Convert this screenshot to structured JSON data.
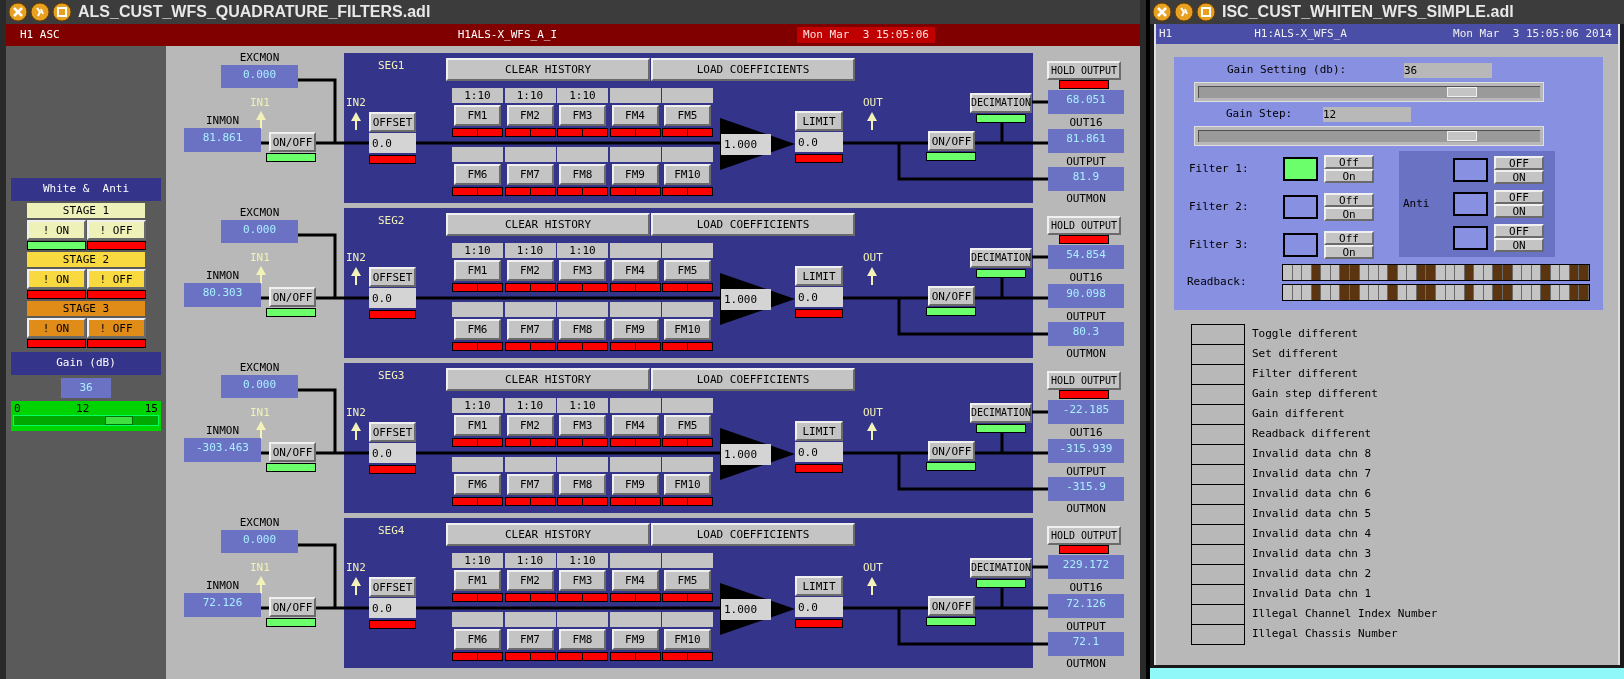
{
  "left_window": {
    "title": "ALS_CUST_WFS_QUADRATURE_FILTERS.adl",
    "header": {
      "site": "H1 ASC",
      "channel": "H1ALS-X_WFS_A_I",
      "datetime": "Mon Mar  3 15:05:06"
    },
    "whitening": {
      "title": "White &  Anti",
      "stages": [
        {
          "label": "STAGE 1",
          "color": "#eef2b8",
          "on_button": "! ON",
          "off_button": "! OFF",
          "on_lit": true,
          "off_lit": false
        },
        {
          "label": "STAGE 2",
          "color": "#f8da40",
          "on_button": "! ON",
          "off_button": "! OFF",
          "on_lit": false,
          "off_lit": false
        },
        {
          "label": "STAGE 3",
          "color": "#e08c18",
          "on_button": "! ON",
          "off_button": "! OFF",
          "on_lit": false,
          "off_lit": false
        }
      ],
      "gain_title": "Gain (dB)",
      "gain_value": "36",
      "slider": {
        "min_label": "0",
        "mid_label": "12",
        "max_label": "15",
        "level": 0.73
      }
    },
    "segments": [
      {
        "name": "SEG1",
        "excmon_label": "EXCMON",
        "excmon": "0.000",
        "inmon_label": "INMON",
        "inmon": "81.861",
        "in1_label": "IN1",
        "in2_label": "IN2",
        "input_switch": {
          "label": "ON/OFF",
          "on": true
        },
        "offset": {
          "label": "OFFSET",
          "value": "0.0",
          "on": false
        },
        "clear_history": "CLEAR HISTORY",
        "load_coefficients": "LOAD COEFFICIENTS",
        "filters": [
          {
            "label": "FM1",
            "ratio": "1:10",
            "on": false
          },
          {
            "label": "FM2",
            "ratio": "1:10",
            "on": false
          },
          {
            "label": "FM3",
            "ratio": "1:10",
            "on": false
          },
          {
            "label": "FM4",
            "on": false
          },
          {
            "label": "FM5",
            "on": false
          },
          {
            "label": "FM6",
            "on": false
          },
          {
            "label": "FM7",
            "on": false
          },
          {
            "label": "FM8",
            "on": false
          },
          {
            "label": "FM9",
            "on": false
          },
          {
            "label": "FM10",
            "on": false
          }
        ],
        "gain": "1.000",
        "limit": {
          "label": "LIMIT",
          "value": "0.0",
          "on": false
        },
        "out_label": "OUT",
        "output_switch": {
          "label": "ON/OFF",
          "on": true
        },
        "decimation": {
          "label": "DECIMATION",
          "on": true
        },
        "hold_output": {
          "label": "HOLD OUTPUT",
          "on": false
        },
        "out16": "68.051",
        "out16_label": "OUT16",
        "output": "81.861",
        "output_label": "OUTPUT",
        "outmon": "81.9",
        "outmon_label": "OUTMON"
      },
      {
        "name": "SEG2",
        "excmon_label": "EXCMON",
        "excmon": "0.000",
        "inmon_label": "INMON",
        "inmon": "80.303",
        "in1_label": "IN1",
        "in2_label": "IN2",
        "input_switch": {
          "label": "ON/OFF",
          "on": true
        },
        "offset": {
          "label": "OFFSET",
          "value": "0.0",
          "on": false
        },
        "clear_history": "CLEAR HISTORY",
        "load_coefficients": "LOAD COEFFICIENTS",
        "filters": [
          {
            "label": "FM1",
            "ratio": "1:10",
            "on": false
          },
          {
            "label": "FM2",
            "ratio": "1:10",
            "on": false
          },
          {
            "label": "FM3",
            "ratio": "1:10",
            "on": false
          },
          {
            "label": "FM4",
            "on": false
          },
          {
            "label": "FM5",
            "on": false
          },
          {
            "label": "FM6",
            "on": false
          },
          {
            "label": "FM7",
            "on": false
          },
          {
            "label": "FM8",
            "on": false
          },
          {
            "label": "FM9",
            "on": false
          },
          {
            "label": "FM10",
            "on": false
          }
        ],
        "gain": "1.000",
        "limit": {
          "label": "LIMIT",
          "value": "0.0",
          "on": false
        },
        "out_label": "OUT",
        "output_switch": {
          "label": "ON/OFF",
          "on": true
        },
        "decimation": {
          "label": "DECIMATION",
          "on": true
        },
        "hold_output": {
          "label": "HOLD OUTPUT",
          "on": false
        },
        "out16": "54.854",
        "out16_label": "OUT16",
        "output": "90.098",
        "output_label": "OUTPUT",
        "outmon": "80.3",
        "outmon_label": "OUTMON"
      },
      {
        "name": "SEG3",
        "excmon_label": "EXCMON",
        "excmon": "0.000",
        "inmon_label": "INMON",
        "inmon": "-303.463",
        "in1_label": "IN1",
        "in2_label": "IN2",
        "input_switch": {
          "label": "ON/OFF",
          "on": true
        },
        "offset": {
          "label": "OFFSET",
          "value": "0.0",
          "on": false
        },
        "clear_history": "CLEAR HISTORY",
        "load_coefficients": "LOAD COEFFICIENTS",
        "filters": [
          {
            "label": "FM1",
            "ratio": "1:10",
            "on": false
          },
          {
            "label": "FM2",
            "ratio": "1:10",
            "on": false
          },
          {
            "label": "FM3",
            "ratio": "1:10",
            "on": false
          },
          {
            "label": "FM4",
            "on": false
          },
          {
            "label": "FM5",
            "on": false
          },
          {
            "label": "FM6",
            "on": false
          },
          {
            "label": "FM7",
            "on": false
          },
          {
            "label": "FM8",
            "on": false
          },
          {
            "label": "FM9",
            "on": false
          },
          {
            "label": "FM10",
            "on": false
          }
        ],
        "gain": "1.000",
        "limit": {
          "label": "LIMIT",
          "value": "0.0",
          "on": false
        },
        "out_label": "OUT",
        "output_switch": {
          "label": "ON/OFF",
          "on": true
        },
        "decimation": {
          "label": "DECIMATION",
          "on": true
        },
        "hold_output": {
          "label": "HOLD OUTPUT",
          "on": false
        },
        "out16": "-22.185",
        "out16_label": "OUT16",
        "output": "-315.939",
        "output_label": "OUTPUT",
        "outmon": "-315.9",
        "outmon_label": "OUTMON"
      },
      {
        "name": "SEG4",
        "excmon_label": "EXCMON",
        "excmon": "0.000",
        "inmon_label": "INMON",
        "inmon": "72.126",
        "in1_label": "IN1",
        "in2_label": "IN2",
        "input_switch": {
          "label": "ON/OFF",
          "on": true
        },
        "offset": {
          "label": "OFFSET",
          "value": "0.0",
          "on": false
        },
        "clear_history": "CLEAR HISTORY",
        "load_coefficients": "LOAD COEFFICIENTS",
        "filters": [
          {
            "label": "FM1",
            "ratio": "1:10",
            "on": false
          },
          {
            "label": "FM2",
            "ratio": "1:10",
            "on": false
          },
          {
            "label": "FM3",
            "ratio": "1:10",
            "on": false
          },
          {
            "label": "FM4",
            "on": false
          },
          {
            "label": "FM5",
            "on": false
          },
          {
            "label": "FM6",
            "on": false
          },
          {
            "label": "FM7",
            "on": false
          },
          {
            "label": "FM8",
            "on": false
          },
          {
            "label": "FM9",
            "on": false
          },
          {
            "label": "FM10",
            "on": false
          }
        ],
        "gain": "1.000",
        "limit": {
          "label": "LIMIT",
          "value": "0.0",
          "on": false
        },
        "out_label": "OUT",
        "output_switch": {
          "label": "ON/OFF",
          "on": true
        },
        "decimation": {
          "label": "DECIMATION",
          "on": true
        },
        "hold_output": {
          "label": "HOLD OUTPUT",
          "on": false
        },
        "out16": "229.172",
        "out16_label": "OUT16",
        "output": "72.126",
        "output_label": "OUTPUT",
        "outmon": "72.1",
        "outmon_label": "OUTMON"
      }
    ]
  },
  "right_window": {
    "title": "ISC_CUST_WHITEN_WFS_SIMPLE.adl",
    "header": {
      "site": "H1",
      "channel": "H1:ALS-X_WFS_A",
      "datetime": "Mon Mar  3 15:05:06 2014"
    },
    "gain_setting": {
      "label": "Gain Setting (db):",
      "value": "36",
      "level": 0.77
    },
    "gain_step": {
      "label": "Gain Step:",
      "value": "12",
      "level": 0.77
    },
    "filters": [
      {
        "label": "Filter 1:",
        "on": true,
        "off_button": "Off",
        "on_button": "On"
      },
      {
        "label": "Filter 2:",
        "on": false,
        "off_button": "Off",
        "on_button": "On"
      },
      {
        "label": "Filter 3:",
        "on": false,
        "off_button": "Off",
        "on_button": "On"
      }
    ],
    "anti": {
      "label": "Anti",
      "rows": [
        {
          "on": false,
          "off_button": "OFF",
          "on_button": "ON"
        },
        {
          "on": false,
          "off_button": "OFF",
          "on_button": "ON"
        },
        {
          "on": false,
          "off_button": "OFF",
          "on_button": "ON"
        }
      ]
    },
    "readback": {
      "label": "Readback:",
      "rows": [
        {
          "bits": [
            false,
            false,
            false,
            true,
            false,
            false,
            true,
            true,
            false,
            false,
            false,
            true,
            false,
            false,
            true,
            true,
            false,
            false,
            false,
            true,
            false,
            false,
            true,
            true,
            false,
            false,
            false,
            true,
            false,
            false,
            true,
            true
          ]
        },
        {
          "bits": [
            false,
            false,
            false,
            true,
            false,
            false,
            true,
            true,
            false,
            false,
            false,
            true,
            false,
            false,
            true,
            true,
            false,
            false,
            false,
            true,
            false,
            false,
            true,
            true,
            false,
            false,
            false,
            true,
            false,
            false,
            true,
            true
          ]
        }
      ]
    },
    "status": [
      {
        "label": "Toggle different"
      },
      {
        "label": "Set different"
      },
      {
        "label": "Filter different"
      },
      {
        "label": "Gain step different"
      },
      {
        "label": "Gain different"
      },
      {
        "label": "Readback different"
      },
      {
        "label": "Invalid data chn 8"
      },
      {
        "label": "Invalid data chn 7"
      },
      {
        "label": "Invalid data chn 6"
      },
      {
        "label": "Invalid data chn 5"
      },
      {
        "label": "Invalid data chn 4"
      },
      {
        "label": "Invalid data chn 3"
      },
      {
        "label": "Invalid data chn 2"
      },
      {
        "label": "Invalid Data chn 1"
      },
      {
        "label": "Illegal Channel Index Number"
      },
      {
        "label": "Illegal Chassis Number"
      }
    ]
  }
}
